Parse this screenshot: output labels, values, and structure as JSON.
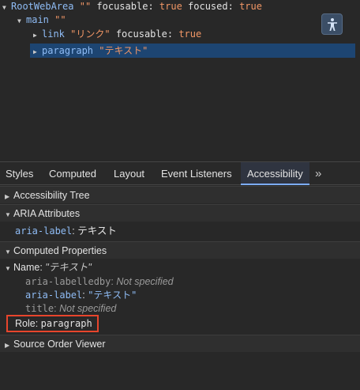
{
  "tree": {
    "root": {
      "role": "RootWebArea",
      "name": "\"\"",
      "k1": "focusable",
      "v1": "true",
      "k2": "focused",
      "v2": "true"
    },
    "main": {
      "role": "main",
      "name": "\"\""
    },
    "link": {
      "role": "link",
      "name": "\"リンク\"",
      "k1": "focusable",
      "v1": "true"
    },
    "paragraph": {
      "role": "paragraph",
      "name": "\"テキスト\""
    }
  },
  "tabs": [
    "Styles",
    "Computed",
    "Layout",
    "Event Listeners",
    "Accessibility"
  ],
  "active_tab": "Accessibility",
  "more_tabs": "»",
  "sections": {
    "tree": "Accessibility Tree",
    "aria": "ARIA Attributes",
    "computed": "Computed Properties",
    "source": "Source Order Viewer"
  },
  "aria_attr": {
    "name": "aria-label",
    "value": "テキスト"
  },
  "computed": {
    "name_label": "Name:",
    "name_value": "\"テキスト\"",
    "labelledby_key": "aria-labelledby",
    "labelledby_value": "Not specified",
    "label_key": "aria-label",
    "label_value": "\"テキスト\"",
    "title_key": "title",
    "title_value": "Not specified",
    "role_label": "Role:",
    "role_value": "paragraph"
  },
  "colors": {
    "selection": "#1d4572",
    "highlight_box": "#e8452c",
    "accent_tab": "#7cacf8"
  }
}
